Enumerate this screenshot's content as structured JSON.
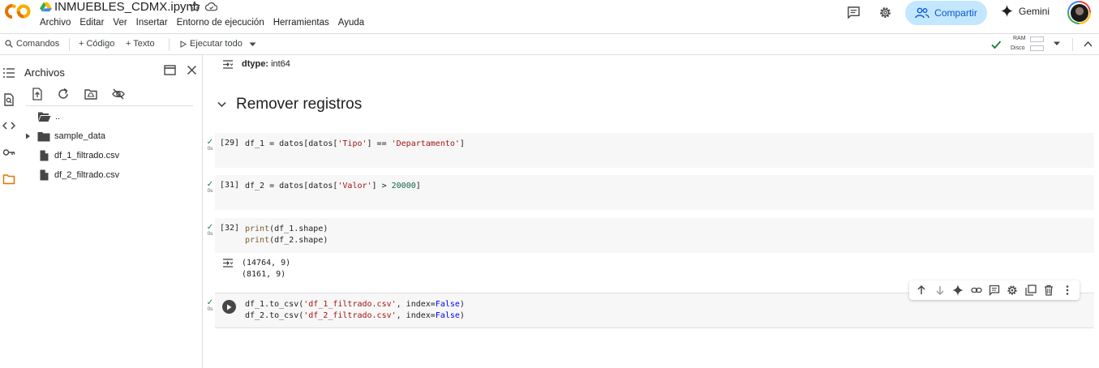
{
  "header": {
    "notebook_title": "INMUEBLES_CDMX.ipynb",
    "menu": [
      "Archivo",
      "Editar",
      "Ver",
      "Insertar",
      "Entorno de ejecución",
      "Herramientas",
      "Ayuda"
    ],
    "share_label": "Compartir",
    "gemini_label": "Gemini"
  },
  "toolbar": {
    "commands_label": "Comandos",
    "add_code_label": "+ Código",
    "add_text_label": "+ Texto",
    "run_all_label": "Ejecutar todo",
    "ram_label": "RAM",
    "disk_label": "Disco"
  },
  "files_panel": {
    "title": "Archivos",
    "items": [
      {
        "name": "..",
        "type": "folder-open"
      },
      {
        "name": "sample_data",
        "type": "folder"
      },
      {
        "name": "df_1_filtrado.csv",
        "type": "file"
      },
      {
        "name": "df_2_filtrado.csv",
        "type": "file"
      }
    ]
  },
  "notebook": {
    "prev_output": {
      "dtype_label": "dtype:",
      "dtype_value": "int64"
    },
    "section_title": "Remover registros",
    "cells": [
      {
        "exec_count": "[29]",
        "status_time": "0s",
        "lines": [
          "df_1 = datos[datos['Tipo'] == 'Departamento']"
        ]
      },
      {
        "exec_count": "[31]",
        "status_time": "0s",
        "lines": [
          "df_2 = datos[datos['Valor'] > 20000]"
        ]
      },
      {
        "exec_count": "[32]",
        "status_time": "0s",
        "lines": [
          "print(df_1.shape)",
          "print(df_2.shape)"
        ],
        "output": [
          "(14764, 9)",
          "(8161, 9)"
        ]
      },
      {
        "exec_count": "",
        "status_time": "0s",
        "lines": [
          "df_1.to_csv('df_1_filtrado.csv', index=False)",
          "df_2.to_csv('df_2_filtrado.csv', index=False)"
        ]
      }
    ]
  },
  "colors": {
    "accent": "#0b57d0",
    "share_bg": "#c2e7ff",
    "success": "#188038",
    "logo_orange": "#f9ab00",
    "logo_dark_orange": "#e37400"
  }
}
